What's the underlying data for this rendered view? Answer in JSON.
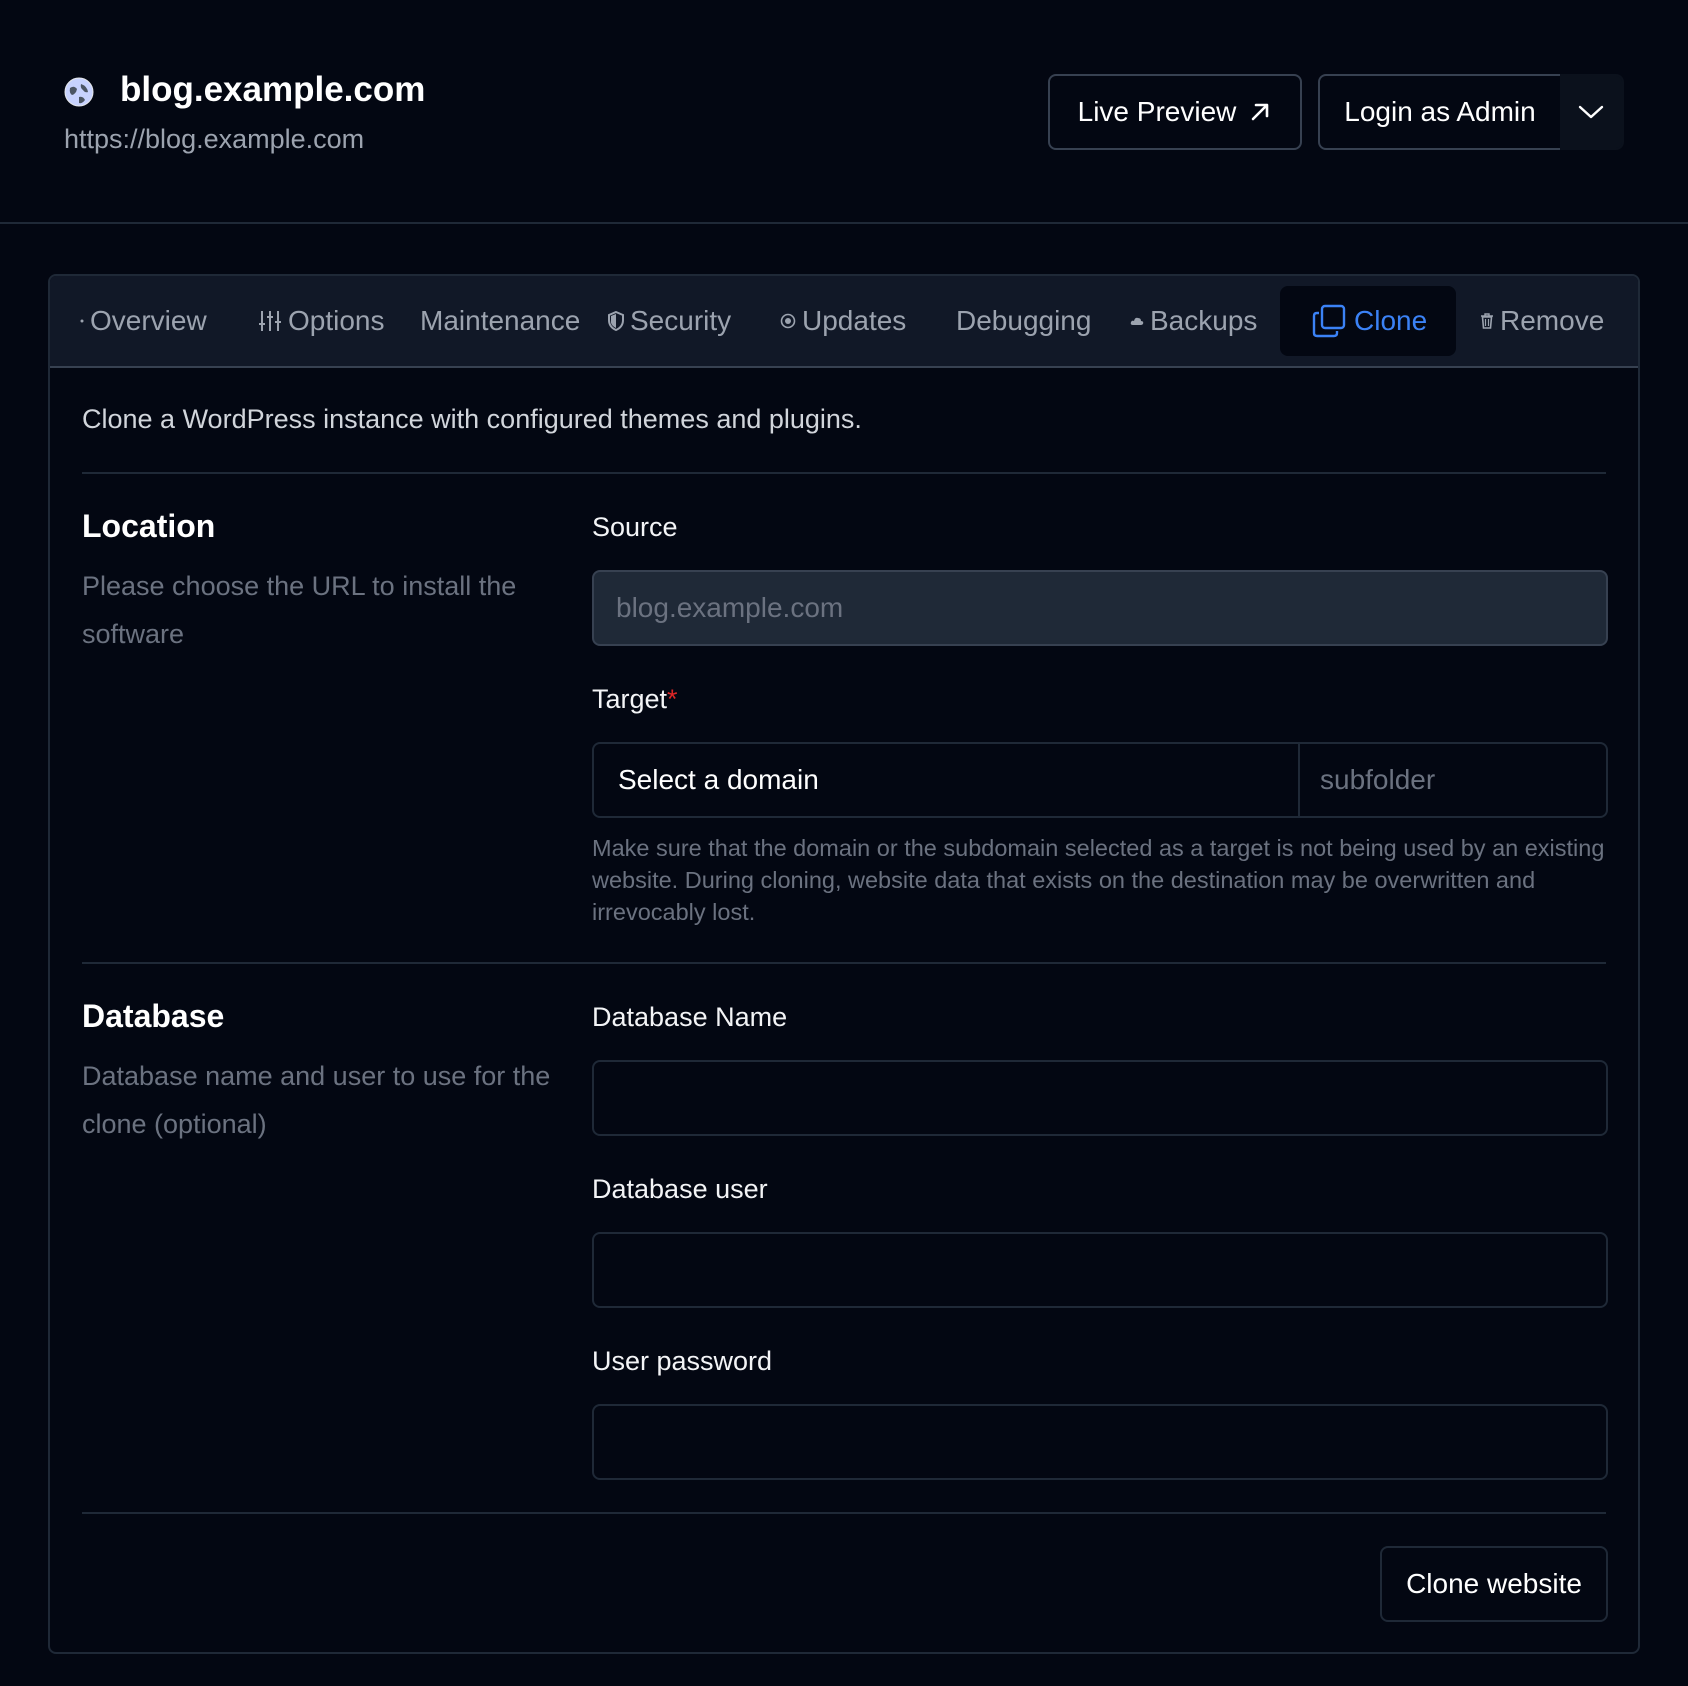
{
  "site": {
    "title": "blog.example.com",
    "url": "https://blog.example.com",
    "icon": "globe-icon"
  },
  "header_actions": {
    "live_preview_label": "Live Preview",
    "login_admin_label": "Login as Admin"
  },
  "tabs": [
    {
      "label": "Overview",
      "icon": "dot-icon"
    },
    {
      "label": "Options",
      "icon": "sliders-icon"
    },
    {
      "label": "Maintenance",
      "icon": ""
    },
    {
      "label": "Security",
      "icon": "shield-icon"
    },
    {
      "label": "Updates",
      "icon": "refresh-icon"
    },
    {
      "label": "Debugging",
      "icon": ""
    },
    {
      "label": "Backups",
      "icon": "cloud-icon"
    },
    {
      "label": "Clone",
      "icon": "copy-icon",
      "active": true
    },
    {
      "label": "Remove",
      "icon": "trash-icon"
    }
  ],
  "intro": "Clone a WordPress instance with configured themes and plugins.",
  "location": {
    "title": "Location",
    "description": "Please choose the URL to install the software",
    "source_label": "Source",
    "source_value": "blog.example.com",
    "target_label": "Target",
    "target_required_mark": "*",
    "domain_select_label": "Select a domain",
    "subfolder_placeholder": "subfolder",
    "help_text": "Make sure that the domain or the subdomain selected as a target is not being used by an existing website. During cloning, website data that exists on the destination may be overwritten and irrevocably lost."
  },
  "database": {
    "title": "Database",
    "description": "Database name and user to use for the clone (optional)",
    "name_label": "Database Name",
    "name_value": "",
    "user_label": "Database user",
    "user_value": "",
    "password_label": "User password",
    "password_value": ""
  },
  "actions": {
    "clone_button_label": "Clone website"
  },
  "colors": {
    "background": "#030712",
    "panel_tabs": "#111827",
    "accent": "#3b82f6",
    "required": "#dc2626",
    "muted_text": "#6b7280"
  }
}
